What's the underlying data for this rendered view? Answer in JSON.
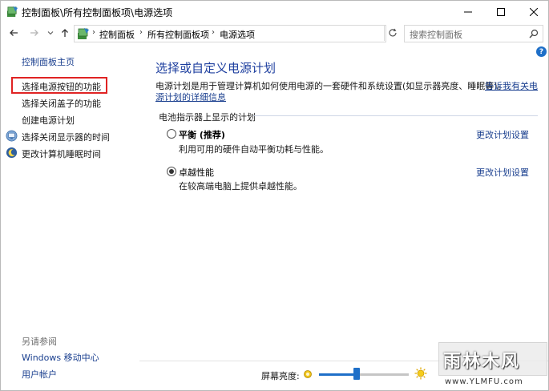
{
  "window": {
    "title": "控制面板\\所有控制面板项\\电源选项",
    "icons": {
      "app": "control-panel-icon",
      "minimize": "minimize-icon",
      "maximize": "maximize-icon",
      "close": "close-icon"
    }
  },
  "nav": {
    "crumbs": [
      "控制面板",
      "所有控制面板项",
      "电源选项"
    ],
    "search_placeholder": "搜索控制面板"
  },
  "sidebar": {
    "home": "控制面板主页",
    "items": [
      {
        "label": "选择电源按钮的功能",
        "icon": ""
      },
      {
        "label": "选择关闭盖子的功能",
        "icon": ""
      },
      {
        "label": "创建电源计划",
        "icon": ""
      },
      {
        "label": "选择关闭显示器的时间",
        "icon": "monitor-icon"
      },
      {
        "label": "更改计算机睡眠时间",
        "icon": "moon-icon"
      }
    ],
    "see_also": "另请参阅",
    "see_also_links": [
      "Windows 移动中心",
      "用户帐户"
    ]
  },
  "help": {
    "label": "?"
  },
  "main": {
    "title": "选择或自定义电源计划",
    "description": "电源计划是用于管理计算机如何使用电源的一套硬件和系统设置(如显示器亮度、睡眠等)。",
    "link_line1": "告诉我有关电",
    "link_line2": "源计划的详细信息",
    "section_label": "电池指示器上显示的计划",
    "plans": [
      {
        "name": "平衡",
        "suffix": " (推荐)",
        "desc": "利用可用的硬件自动平衡功耗与性能。",
        "selected": false,
        "change": "更改计划设置"
      },
      {
        "name": "卓越性能",
        "suffix": "",
        "desc": "在较高端电脑上提供卓越性能。",
        "selected": true,
        "change": "更改计划设置"
      }
    ]
  },
  "brightness": {
    "label": "屏幕亮度:",
    "value_fraction": 0.42
  },
  "watermark": {
    "text": "雨林木风",
    "url": "www.YLMFU.com"
  }
}
